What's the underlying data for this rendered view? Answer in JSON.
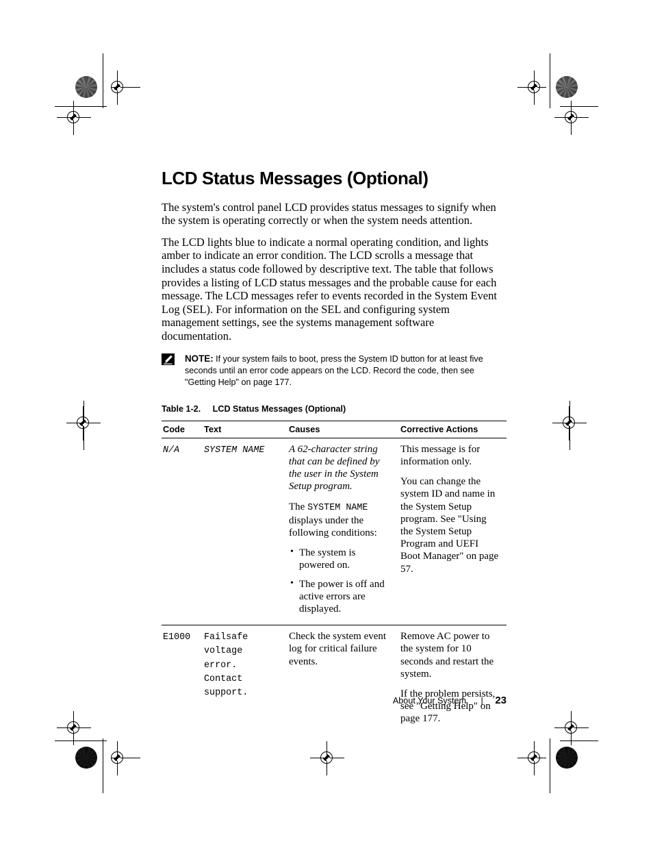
{
  "document": {
    "title": "LCD Status Messages (Optional)",
    "paragraphs": [
      "The system's control panel LCD provides status messages to signify when the system is operating correctly or when the system needs attention.",
      "The LCD lights blue to indicate a normal operating condition, and lights amber to indicate an error condition. The LCD scrolls a message that includes a status code followed by descriptive text. The table that follows provides a listing of LCD status messages and the probable cause for each message. The LCD messages refer to events recorded in the System Event Log (SEL). For information on the SEL and configuring system management settings, see the systems management software documentation."
    ]
  },
  "note": {
    "icon": "note-pencil-icon",
    "label": "NOTE:",
    "text": "If your system fails to boot, press the System ID button for at least five seconds until an error code appears on the LCD. Record the code, then see \"Getting Help\" on page 177."
  },
  "table": {
    "caption_number": "Table 1-2.",
    "caption_title": "LCD Status Messages (Optional)",
    "headers": [
      "Code",
      "Text",
      "Causes",
      "Corrective Actions"
    ],
    "rows": [
      {
        "code": "N/A",
        "code_style": "mono-italic",
        "text": "SYSTEM NAME",
        "text_style": "mono-italic",
        "causes": {
          "paragraph_italic": "A 62-character string that can be defined by the user in the System Setup program.",
          "lead_before_mono": "The ",
          "mono_term": "SYSTEM NAME",
          "lead_after_mono": " displays under the following conditions:",
          "bullets": [
            "The system is powered on.",
            "The power is off and active errors are displayed."
          ]
        },
        "actions": [
          "This message is for information only.",
          "You can change the system ID and name in the System Setup program. See \"Using the System Setup Program and UEFI Boot Manager\" on page 57."
        ]
      },
      {
        "code": "E1000",
        "code_style": "mono",
        "text": "Failsafe voltage error. Contact support.",
        "text_style": "mono",
        "causes": {
          "paragraph_plain": "Check the system event log for critical failure events."
        },
        "actions": [
          "Remove AC power to the system for 10 seconds and restart the system.",
          "If the problem persists, see \"Getting Help\" on page 177."
        ]
      }
    ]
  },
  "footer": {
    "section": "About Your System",
    "separator": "|",
    "page_number": "23"
  }
}
